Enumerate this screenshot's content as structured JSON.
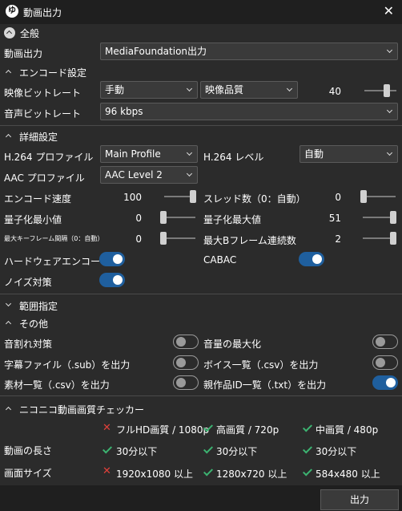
{
  "window": {
    "title": "動画出力",
    "close_glyph": "✕",
    "icon_text": "ゆ"
  },
  "sections": {
    "general": "全般",
    "encode": "エンコード設定",
    "detail": "詳細設定",
    "range": "範囲指定",
    "other": "その他",
    "checker": "ニコニコ動画画質チェッカー"
  },
  "general": {
    "video_output_label": "動画出力",
    "video_output_value": "MediaFoundation出力"
  },
  "encode": {
    "video_bitrate_label": "映像ビットレート",
    "bitrate_mode": "手動",
    "quality_mode": "映像品質",
    "quality_value": "40",
    "quality_level": 0.75,
    "audio_bitrate_label": "音声ビットレート",
    "audio_bitrate_value": "96 kbps"
  },
  "detail": {
    "h264_profile_label": "H.264 プロファイル",
    "h264_profile_value": "Main Profile",
    "h264_level_label": "H.264 レベル",
    "h264_level_value": "自動",
    "aac_profile_label": "AAC プロファイル",
    "aac_profile_value": "AAC Level 2",
    "encode_speed_label": "エンコード速度",
    "encode_speed_value": "100",
    "threads_label": "スレッド数（0：自動）",
    "threads_value": "0",
    "qmin_label": "量子化最小値",
    "qmin_value": "0",
    "qmax_label": "量子化最大値",
    "qmax_value": "51",
    "keyframe_label": "最大キーフレーム間隔（0：自動）",
    "keyframe_value": "0",
    "bframe_label": "最大Bフレーム連続数",
    "bframe_value": "2",
    "hw_encode_label": "ハードウェアエンコード",
    "cabac_label": "CABAC",
    "noise_label": "ノイズ対策"
  },
  "other": {
    "crack_label": "音割れ対策",
    "maximize_label": "音量の最大化",
    "subtitle_label": "字幕ファイル（.sub）を出力",
    "voice_list_label": "ボイス一覧（.csv）を出力",
    "material_label": "素材一覧（.csv）を出力",
    "parent_id_label": "親作品ID一覧（.txt）を出力"
  },
  "checker": {
    "quality_1080": "フルHD画質 / 1080p",
    "quality_720": "高画質 / 720p",
    "quality_480": "中画質 / 480p",
    "length_label": "動画の長さ",
    "length_1080": "30分以下",
    "length_720": "30分以下",
    "length_480": "30分以下",
    "size_label": "画面サイズ",
    "size_1080": "1920x1080 以上",
    "size_720": "1280x720 以上",
    "size_480": "584x480 以上"
  },
  "footer": {
    "output_button": "出力"
  },
  "colors": {
    "toggle_on": "#1f5f9e",
    "check": "#3cb371",
    "cross": "#e0403a"
  }
}
